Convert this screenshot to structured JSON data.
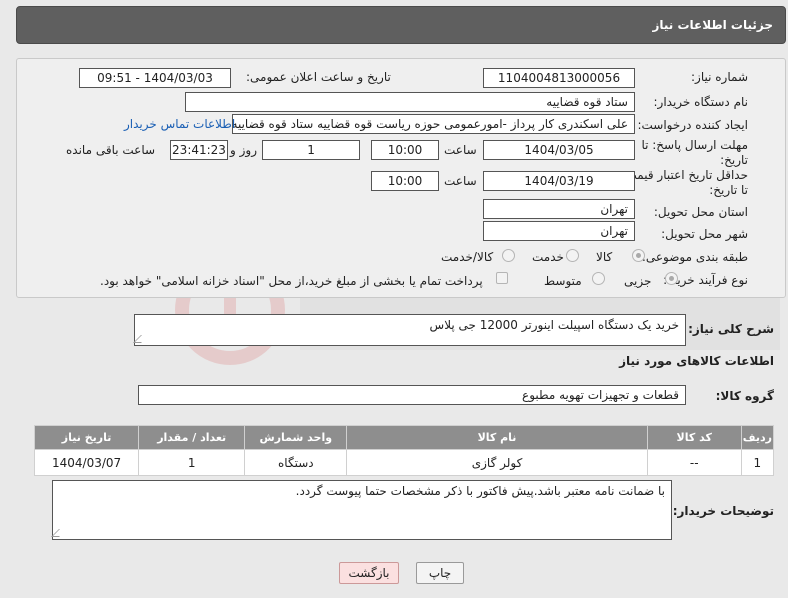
{
  "header": {
    "title": "جزئیات اطلاعات نیاز"
  },
  "form": {
    "need_number_label": "شماره نیاز:",
    "need_number": "1104004813000056",
    "announce_label": "تاریخ و ساعت اعلان عمومی:",
    "announce_value": "1404/03/03 - 09:51",
    "buyer_label": "نام دستگاه خریدار:",
    "buyer_value": "ستاد قوه قضاییه",
    "creator_label": "ایجاد کننده درخواست:",
    "creator_value": "علی اسکندری کار پرداز -امورعمومی حوزه ریاست قوه قضاییه ستاد قوه قضاییه",
    "contact_link": "اطلاعات تماس خریدار",
    "deadline_label_1": "مهلت ارسال پاسخ: تا",
    "deadline_label_2": "تاریخ:",
    "deadline_date": "1404/03/05",
    "time_label": "ساعت",
    "deadline_time": "10:00",
    "days_value": "1",
    "days_label": "روز و",
    "remaining_time": "23:41:23",
    "remaining_label": "ساعت باقی مانده",
    "validity_label_1": "حداقل تاریخ اعتبار قیمت:",
    "validity_label_2": "تا تاریخ:",
    "validity_date": "1404/03/19",
    "validity_time": "10:00",
    "province_label": "استان محل تحویل:",
    "province_value": "تهران",
    "city_label": "شهر محل تحویل:",
    "city_value": "تهران",
    "category_label": "طبقه بندی موضوعی:",
    "category_options": [
      "کالا",
      "خدمت",
      "کالا/خدمت"
    ],
    "process_label": "نوع فرآیند خرید :",
    "process_options": [
      "جزیی",
      "متوسط"
    ],
    "payment_note": "پرداخت تمام یا بخشی از مبلغ خرید،از محل \"اسناد خزانه اسلامی\" خواهد بود."
  },
  "description": {
    "label": "شرح کلی نیاز:",
    "value": "خرید یک دستگاه اسپیلت اینورتر 12000 جی پلاس"
  },
  "goods": {
    "section_title": "اطلاعات کالاهای مورد نیاز",
    "group_label": "گروه کالا:",
    "group_value": "قطعات و تجهیزات تهویه مطبوع",
    "columns": [
      "ردیف",
      "کد کالا",
      "نام کالا",
      "واحد شمارش",
      "تعداد / مقدار",
      "تاریخ نیاز"
    ],
    "rows": [
      {
        "row": "1",
        "code": "--",
        "name": "کولر گازی",
        "unit": "دستگاه",
        "qty": "1",
        "date": "1404/03/07"
      }
    ]
  },
  "buyer_notes": {
    "label": "توضیحات خریدار:",
    "value": "با ضمانت نامه معتبر باشد.پیش فاکتور با ذکر مشخصات حتما پیوست گردد."
  },
  "actions": {
    "print": "چاپ",
    "back": "بازگشت"
  },
  "colors": {
    "header_bg": "#5f5f5f",
    "table_header": "#8e8e8e",
    "link": "#1a5fb4",
    "back_btn": "#fbe0e0"
  }
}
